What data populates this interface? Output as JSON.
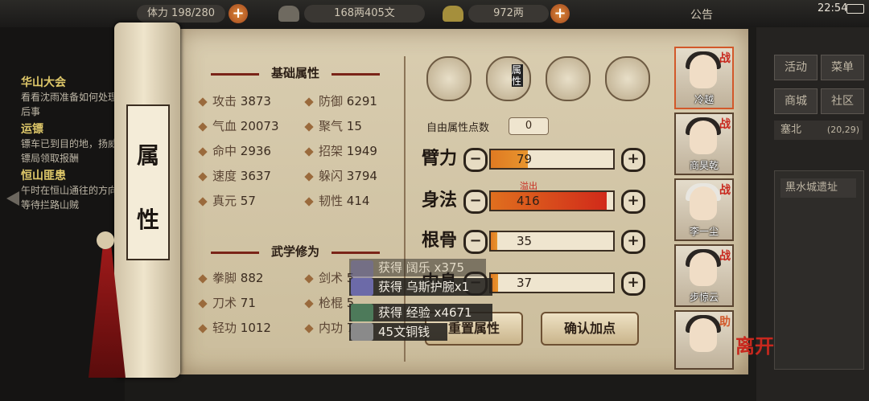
{
  "topbar": {
    "stamina": "体力 198/280",
    "coins": "168两405文",
    "ingots": "972两",
    "notice": "公告",
    "time": "22:54"
  },
  "quests": [
    {
      "title": "华山大会",
      "text": "看看沈雨准备如何处理后事"
    },
    {
      "title": "运镖",
      "text": "镖车已到目的地，扬威镖局领取报酬"
    },
    {
      "title": "恒山匪患",
      "text": "午时在恒山通往的方向等待拦路山贼"
    }
  ],
  "scroll_label": [
    "属",
    "性"
  ],
  "basic": {
    "title": "基础属性",
    "stats": [
      {
        "label": "攻击",
        "value": "3873"
      },
      {
        "label": "防御",
        "value": "6291"
      },
      {
        "label": "气血",
        "value": "20073"
      },
      {
        "label": "聚气",
        "value": "15"
      },
      {
        "label": "命中",
        "value": "2936"
      },
      {
        "label": "招架",
        "value": "1949"
      },
      {
        "label": "速度",
        "value": "3637"
      },
      {
        "label": "躲闪",
        "value": "3794"
      },
      {
        "label": "真元",
        "value": "57"
      },
      {
        "label": "韧性",
        "value": "414"
      }
    ]
  },
  "martial": {
    "title": "武学修为",
    "stats": [
      {
        "label": "拳脚",
        "value": "882"
      },
      {
        "label": "剑术",
        "value": "5"
      },
      {
        "label": "刀术",
        "value": "71"
      },
      {
        "label": "枪棍",
        "value": "5"
      },
      {
        "label": "轻功",
        "value": "1012"
      },
      {
        "label": "内功",
        "value": "7"
      }
    ]
  },
  "tabs": [
    {
      "name": "equipment-icon"
    },
    {
      "name": "attribute-tab",
      "label": "属性"
    },
    {
      "name": "bagua-icon"
    },
    {
      "name": "meridian-icon"
    }
  ],
  "free_points": {
    "label": "自由属性点数",
    "value": "0"
  },
  "attrs": [
    {
      "label": "臂力",
      "value": "79",
      "fill": 0.3
    },
    {
      "label": "身法",
      "value": "416",
      "fill": 0.95,
      "overflow": "溢出"
    },
    {
      "label": "根骨",
      "value": "35",
      "fill": 0.05
    },
    {
      "label": "内息",
      "value": "37",
      "fill": 0.06
    }
  ],
  "buttons": {
    "reset": "重置属性",
    "confirm": "确认加点"
  },
  "toasts": [
    "获得 阔乐 x375",
    "获得 乌斯护腕x1",
    "获得 经验 x4671",
    "45文铜钱"
  ],
  "heroes": [
    {
      "name": "冷越",
      "tag": "战"
    },
    {
      "name": "商昊乾",
      "tag": "战"
    },
    {
      "name": "李一尘",
      "tag": "战"
    },
    {
      "name": "步惊云",
      "tag": "战"
    },
    {
      "name": "",
      "tag": "助"
    }
  ],
  "leave": "离开",
  "rightmenu": {
    "items": [
      "活动",
      "菜单",
      "商城",
      "社区"
    ],
    "location": "塞北",
    "coords": "(20,29)",
    "place": "黑水城遗址"
  }
}
